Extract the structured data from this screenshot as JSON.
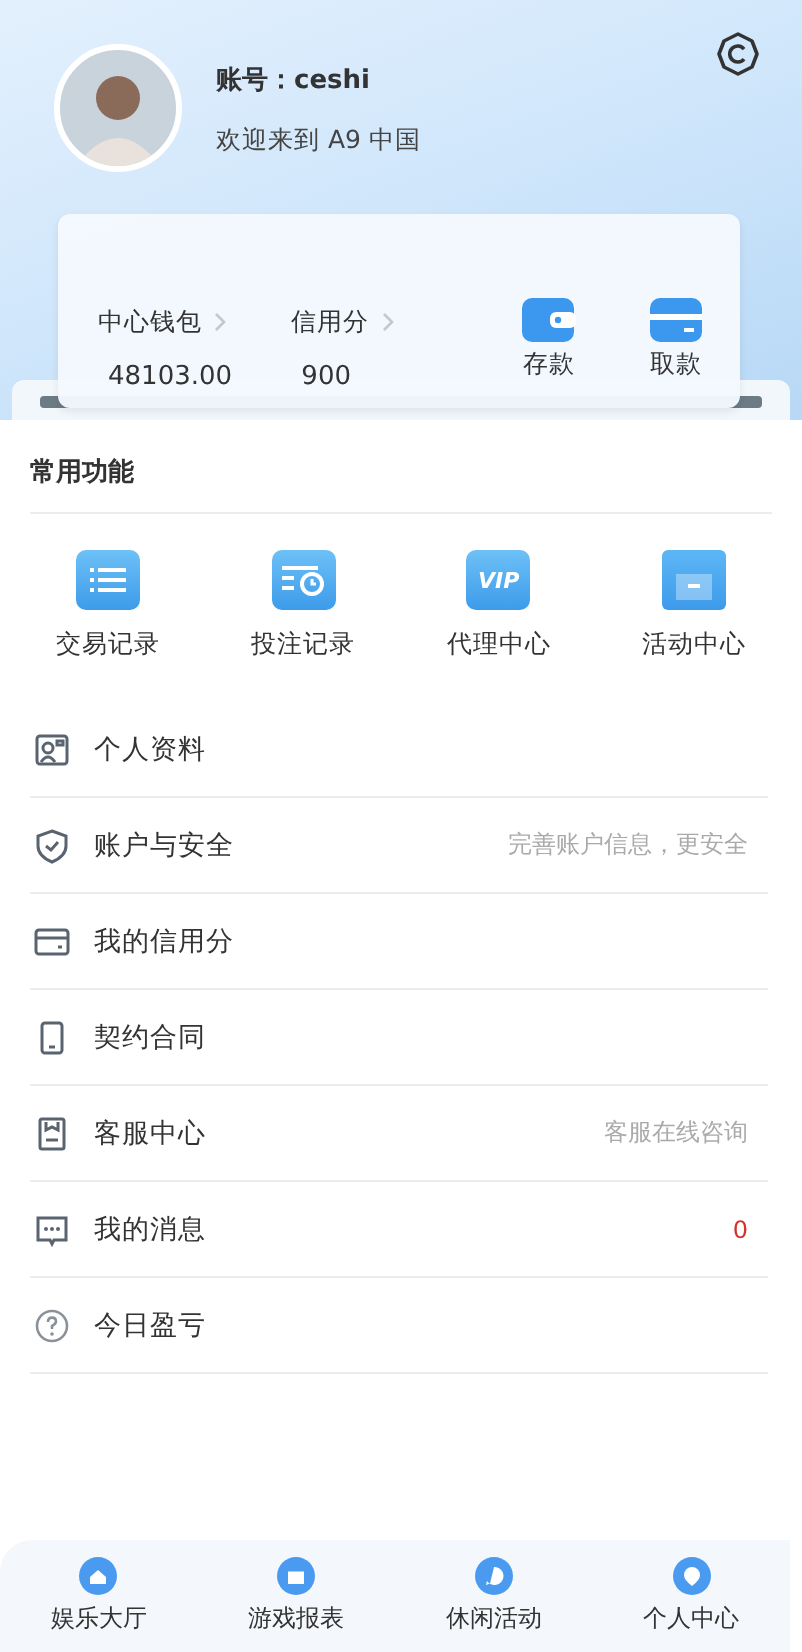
{
  "profile": {
    "account": "账号：ceshi",
    "welcome": "欢迎来到 A9 中国"
  },
  "wallet": {
    "stats": [
      {
        "label": "中心钱包",
        "value": "48103.00"
      },
      {
        "label": "信用分",
        "value": "900"
      }
    ],
    "actions": [
      {
        "kind": "deposit",
        "label": "存款"
      },
      {
        "kind": "withdraw",
        "label": "取款"
      }
    ]
  },
  "features": {
    "title": "常用功能",
    "items": [
      {
        "kind": "list",
        "label": "交易记录"
      },
      {
        "kind": "bets",
        "label": "投注记录"
      },
      {
        "kind": "vip",
        "label": "代理中心",
        "icon_text": "VIP"
      },
      {
        "kind": "gift",
        "label": "活动中心"
      }
    ]
  },
  "menu": [
    {
      "label": "个人资料"
    },
    {
      "label": "账户与安全",
      "hint": "完善账户信息，更安全"
    },
    {
      "label": "我的信用分"
    },
    {
      "label": "契约合同"
    },
    {
      "label": "客服中心",
      "hint": "客服在线咨询"
    },
    {
      "label": "我的消息",
      "count": "0"
    },
    {
      "label": "今日盈亏"
    }
  ],
  "tab_bar": [
    {
      "label": "娱乐大厅"
    },
    {
      "label": "游戏报表"
    },
    {
      "label": "休闲活动"
    },
    {
      "label": "个人中心"
    }
  ]
}
